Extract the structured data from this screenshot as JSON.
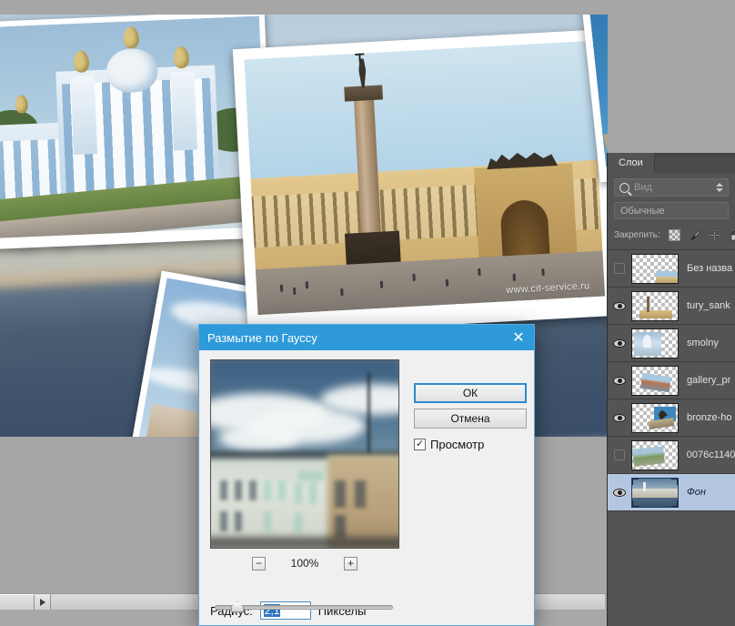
{
  "app": {
    "kind": "photo-editor",
    "locale": "ru"
  },
  "canvas": {
    "photos": [
      {
        "name": "smolny-cathedral-photo",
        "caption": ""
      },
      {
        "name": "palace-square-photo",
        "watermark": "www.cit-service.ru"
      },
      {
        "name": "bronze-horseman-photo",
        "caption": ""
      },
      {
        "name": "gallery-embankment-photo",
        "caption": ""
      }
    ]
  },
  "scrollbar": {
    "arrow_glyph": "▶"
  },
  "dialog": {
    "title": "Размытие по Гауссу",
    "close_glyph": "✕",
    "ok_label": "ОК",
    "cancel_label": "Отмена",
    "preview_label": "Просмотр",
    "preview_checked_glyph": "✓",
    "zoom": {
      "minus": "−",
      "value": "100%",
      "plus": "+"
    },
    "radius": {
      "label": "Радиус:",
      "value": "2,1",
      "units": "Пикселы"
    },
    "accent_color": "#2e9ada",
    "selection_color": "#2f74c0"
  },
  "layers_panel": {
    "tab_label": "Слои",
    "filter_placeholder": "Вид",
    "blend_mode": "Обычные",
    "lock_label": "Закрепить:",
    "lock_icons": [
      "transparency-lock-icon",
      "brush-lock-icon",
      "move-lock-icon",
      "all-lock-icon"
    ],
    "selected_color": "#b5c7e0",
    "layers": [
      {
        "name": "Без назва",
        "visible": false,
        "selected": false,
        "thumb": "palace-square"
      },
      {
        "name": "tury_sank",
        "visible": true,
        "selected": false,
        "thumb": "alexander-column"
      },
      {
        "name": "smolny",
        "visible": true,
        "selected": false,
        "thumb": "smolny"
      },
      {
        "name": "gallery_pr",
        "visible": true,
        "selected": false,
        "thumb": "gallery"
      },
      {
        "name": "bronze-ho",
        "visible": true,
        "selected": false,
        "thumb": "bronze-horseman"
      },
      {
        "name": "0076c1140",
        "visible": false,
        "selected": false,
        "thumb": "aerial"
      },
      {
        "name": "Фон",
        "visible": true,
        "selected": true,
        "thumb": "embankment"
      }
    ]
  }
}
